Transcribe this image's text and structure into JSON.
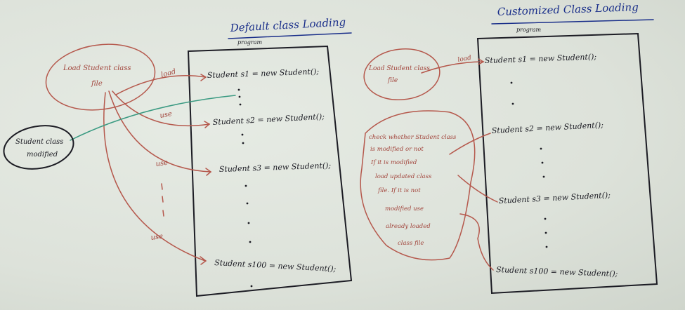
{
  "left": {
    "title": "Default class Loading",
    "program_label": "program",
    "bubble_load": [
      "Load Student class",
      "file"
    ],
    "bubble_modified": [
      "Student class",
      "modified"
    ],
    "arrow_load": "load",
    "arrow_use_1": "use",
    "arrow_use_2": "use",
    "arrow_use_3": "use",
    "stmt_1": "Student s1 = new Student();",
    "stmt_2": "Student s2 = new Student();",
    "stmt_3": "Student s3 = new Student();",
    "stmt_100": "Student s100 = new Student();"
  },
  "right": {
    "title": "Customized Class Loading",
    "program_label": "program",
    "bubble_load": [
      "Load Student class",
      "file"
    ],
    "arrow_load": "load",
    "check_text": [
      "check whether Student class",
      "is modified or not",
      "If it is modified",
      "load updated class",
      "file. If it is not",
      "modified use",
      "already loaded",
      "class file"
    ],
    "stmt_1": "Student s1 = new Student();",
    "stmt_2": "Student s2 = new Student();",
    "stmt_3": "Student s3 = new Student();",
    "stmt_100": "Student s100 = new Student();"
  }
}
